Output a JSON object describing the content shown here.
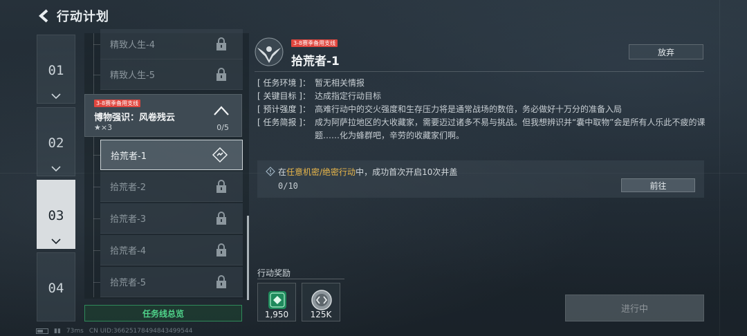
{
  "header": {
    "title": "行动计划",
    "back_icon": "back-arrow-icon"
  },
  "chapters": [
    {
      "label": "01",
      "active": false
    },
    {
      "label": "02",
      "active": false
    },
    {
      "label": "03",
      "active": true
    },
    {
      "label": "04",
      "active": false
    }
  ],
  "mission_list": {
    "above_items": [
      {
        "label": "精致人生-4",
        "locked": true
      },
      {
        "label": "精致人生-5",
        "locked": true
      }
    ],
    "group": {
      "tag": "3-8赛季备用支线",
      "name": "博物强识：风卷残云",
      "stars": "★×3",
      "progress": "0/5"
    },
    "items": [
      {
        "label": "拾荒者-1",
        "locked": false,
        "selected": true
      },
      {
        "label": "拾荒者-2",
        "locked": true
      },
      {
        "label": "拾荒者-3",
        "locked": true
      },
      {
        "label": "拾荒者-4",
        "locked": true
      },
      {
        "label": "拾荒者-5",
        "locked": true
      }
    ],
    "overview_button": "任务线总览"
  },
  "detail": {
    "tag": "3-8赛季备用支线",
    "title": "拾荒者-1",
    "abandon_button": "放弃",
    "info": [
      {
        "label": "[ 任务环境 ]：",
        "value": "暂无相关情报"
      },
      {
        "label": "[ 关键目标 ]：",
        "value": "达成指定行动目标"
      },
      {
        "label": "[ 预计强度 ]：",
        "value": "高难行动中的交火强度和生存压力将是通常战场的数倍，务必做好十万分的准备入局"
      },
      {
        "label": "[ 任务简报 ]：",
        "value": "成为阿萨拉地区的大收藏家，需要迈过诸多不易与挑战。但我想辨识并“囊中取物”会是所有人乐此不疲的课题……化为蜂群吧，辛劳的收藏家们啊。"
      }
    ],
    "task": {
      "prefix": "在",
      "highlight": "任意机密/绝密行动",
      "suffix": "中，成功首次开启10次井盖",
      "progress": "0/10",
      "go_button": "前往"
    },
    "rewards_label": "行动奖励",
    "rewards": [
      {
        "amount": "1,950",
        "icon": "green-token-icon"
      },
      {
        "amount": "125K",
        "icon": "silver-coin-icon"
      }
    ],
    "status_button": "进行中"
  },
  "footer": {
    "ping": "73ms",
    "uid": "CN UID:36625178494843499544"
  },
  "colors": {
    "tag_red": "#e0463e",
    "highlight": "#e8b64a",
    "overview_green": "#4fd38a"
  }
}
